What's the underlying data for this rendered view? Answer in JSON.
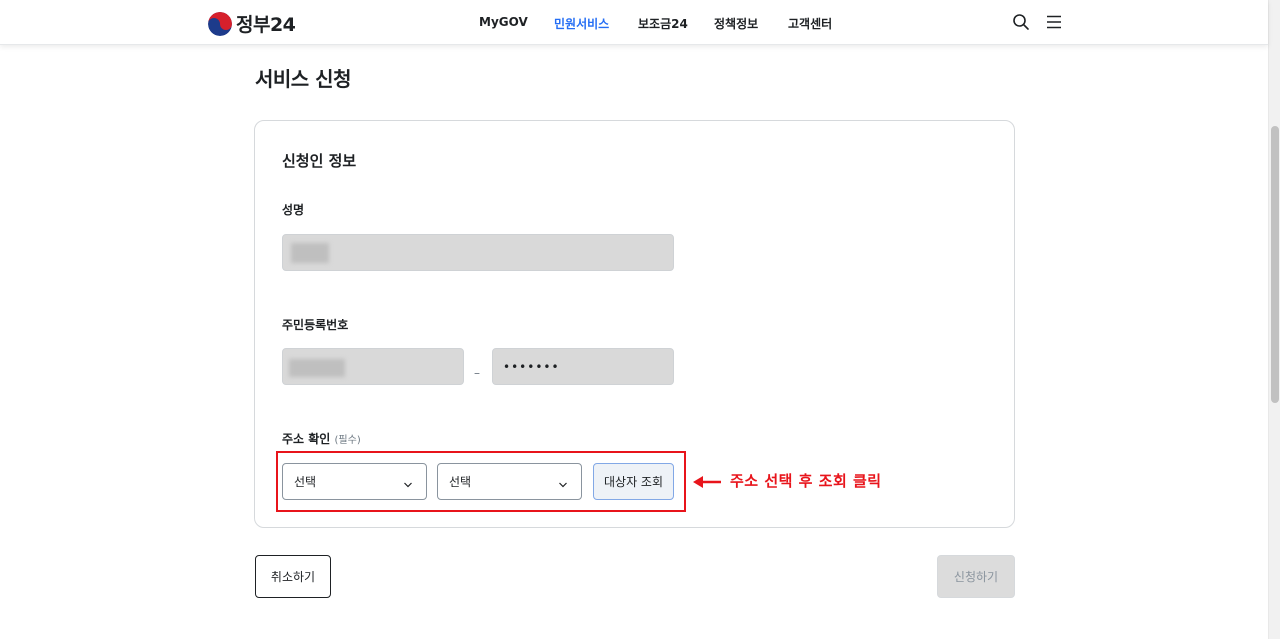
{
  "header": {
    "logo_text": "정부24",
    "nav": [
      {
        "label": "MyGOV",
        "active": false
      },
      {
        "label": "민원서비스",
        "active": true
      },
      {
        "label": "보조금24",
        "active": false
      },
      {
        "label": "정책정보",
        "active": false
      },
      {
        "label": "고객센터",
        "active": false
      }
    ],
    "icons": [
      "search-icon",
      "menu-icon"
    ],
    "accent_color": "#256ef4"
  },
  "page": {
    "title": "서비스 신청"
  },
  "form": {
    "section_title": "신청인 정보",
    "name_label": "성명",
    "rrn_label": "주민등록번호",
    "rrn_separator": "–",
    "rrn_back_masked": "•••••••",
    "address_label": "주소 확인",
    "address_required": "(필수)",
    "select_1": "선택",
    "select_2": "선택",
    "lookup_button": "대상자 조회"
  },
  "annotation": {
    "text": "주소 선택 후 조회 클릭",
    "color": "#e8141b"
  },
  "actions": {
    "cancel_label": "취소하기",
    "submit_label": "신청하기"
  }
}
